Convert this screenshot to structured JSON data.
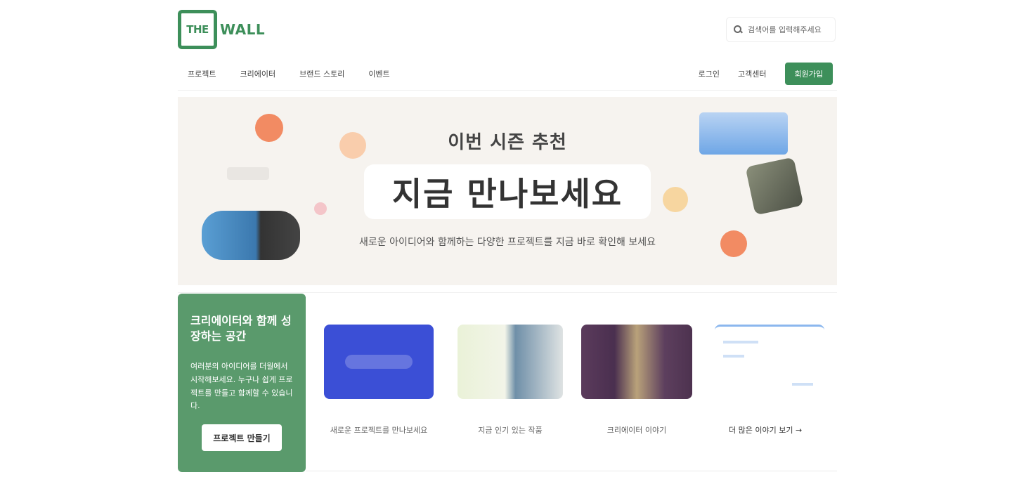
{
  "header": {
    "logo_mark": "THE",
    "logo_word": "WALL",
    "search_placeholder": "검색어를 입력해주세요"
  },
  "nav": {
    "items": [
      "프로젝트",
      "크리에이터",
      "브랜드 스토리",
      "이벤트"
    ],
    "login": "로그인",
    "help": "고객센터",
    "signup": "회원가입"
  },
  "hero": {
    "subtitle": "이번 시즌 추천",
    "title": "지금 만나보세요",
    "description": "새로운 아이디어와 함께하는 다양한 프로젝트를 지금 바로 확인해 보세요"
  },
  "promo": {
    "title": "크리에이터와 함께 성장하는 공간",
    "description": "여러분의 아이디어를 더월에서 시작해보세요. 누구나 쉽게 프로젝트를 만들고 함께할 수 있습니다.",
    "button": "프로젝트 만들기"
  },
  "cards": [
    {
      "caption": "새로운 프로젝트를 만나보세요"
    },
    {
      "caption": "지금 인기 있는 작품"
    },
    {
      "caption": "크리에이터 이야기"
    }
  ],
  "more_link": "더 많은 이야기 보기 →",
  "colors": {
    "brand": "#3d8f5a",
    "promo_bg": "#5a9a6c",
    "hero_bg": "#f6f3ef",
    "accent_orange": "#f28b63",
    "card_blue": "#3b4fd6"
  }
}
